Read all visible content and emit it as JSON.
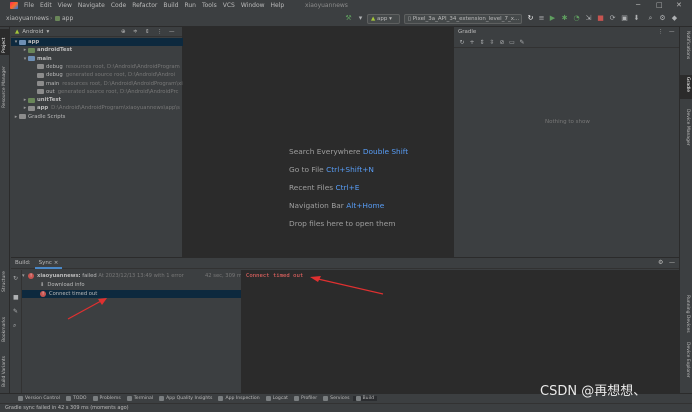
{
  "menubar": {
    "items": [
      "File",
      "Edit",
      "View",
      "Navigate",
      "Code",
      "Refactor",
      "Build",
      "Run",
      "Tools",
      "VCS",
      "Window",
      "Help"
    ],
    "title": "xiaoyuannews"
  },
  "navbar": {
    "project": "xiaoyuannews",
    "module": "app",
    "run_config": "app",
    "device": "Pixel_3a_API_34_extension_level_7_x..."
  },
  "left_strip": [
    "Project",
    "Resource Manager",
    "Structure",
    "Bookmarks",
    "Build Variants"
  ],
  "right_strip": [
    "Notifications",
    "Gradle",
    "Device Manager",
    "Running Devices",
    "Device Explorer"
  ],
  "project_panel": {
    "view": "Android",
    "tree": [
      {
        "name": "app",
        "dim": "",
        "depth": 0,
        "arrow": "▾",
        "folder": "blue",
        "selected": true
      },
      {
        "name": "androidTest",
        "dim": "",
        "depth": 1,
        "arrow": "▸",
        "folder": "green",
        "selected": false
      },
      {
        "name": "main",
        "dim": "",
        "depth": 1,
        "arrow": "▾",
        "folder": "blue",
        "selected": false
      },
      {
        "name": "debug",
        "dim": "resources root, D:\\Android\\AndroidProgram",
        "depth": 2,
        "arrow": "",
        "folder": "gray",
        "selected": false
      },
      {
        "name": "debug",
        "dim": "generated source root, D:\\Android\\Androi",
        "depth": 2,
        "arrow": "",
        "folder": "gray",
        "selected": false
      },
      {
        "name": "main",
        "dim": "resources root, D:\\Android\\AndroidProgram\\xiaoyuannews\\",
        "depth": 2,
        "arrow": "",
        "folder": "gray",
        "selected": false
      },
      {
        "name": "out",
        "dim": "generated source root, D:\\Android\\AndroidPrc",
        "depth": 2,
        "arrow": "",
        "folder": "gray",
        "selected": false
      },
      {
        "name": "unitTest",
        "dim": "",
        "depth": 1,
        "arrow": "▸",
        "folder": "green",
        "selected": false
      },
      {
        "name": "app",
        "dim": "D:\\Android\\AndroidProgram\\xiaoyuannews\\app\\s",
        "depth": 1,
        "arrow": "▸",
        "folder": "gray",
        "selected": false
      },
      {
        "name": "Gradle Scripts",
        "dim": "",
        "depth": 0,
        "arrow": "▸",
        "folder": "gray",
        "selected": false
      }
    ]
  },
  "editor_hints": [
    {
      "text": "Search Everywhere",
      "key": "Double Shift"
    },
    {
      "text": "Go to File",
      "key": "Ctrl+Shift+N"
    },
    {
      "text": "Recent Files",
      "key": "Ctrl+E"
    },
    {
      "text": "Navigation Bar",
      "key": "Alt+Home"
    },
    {
      "text": "Drop files here to open them",
      "key": ""
    }
  ],
  "gradle_panel": {
    "title": "Gradle",
    "empty": "Nothing to show"
  },
  "build_panel": {
    "label": "Build:",
    "tab": "Sync",
    "tree": [
      {
        "project": "xiaoyuannews:",
        "status": "failed",
        "time": "At 2023/12/13 13:49 with 1 error",
        "duration": "42 sec, 309 ms"
      },
      {
        "text": "Download info"
      },
      {
        "text": "Connect timed out"
      }
    ],
    "output": "Connect timed out"
  },
  "bottom_tools": [
    "Version Control",
    "TODO",
    "Problems",
    "Terminal",
    "App Quality Insights",
    "App Inspection",
    "Logcat",
    "Profiler",
    "Services",
    "Build"
  ],
  "status": "Gradle sync failed in 42 s 309 ms (moments ago)",
  "watermark": "CSDN @再想想、"
}
